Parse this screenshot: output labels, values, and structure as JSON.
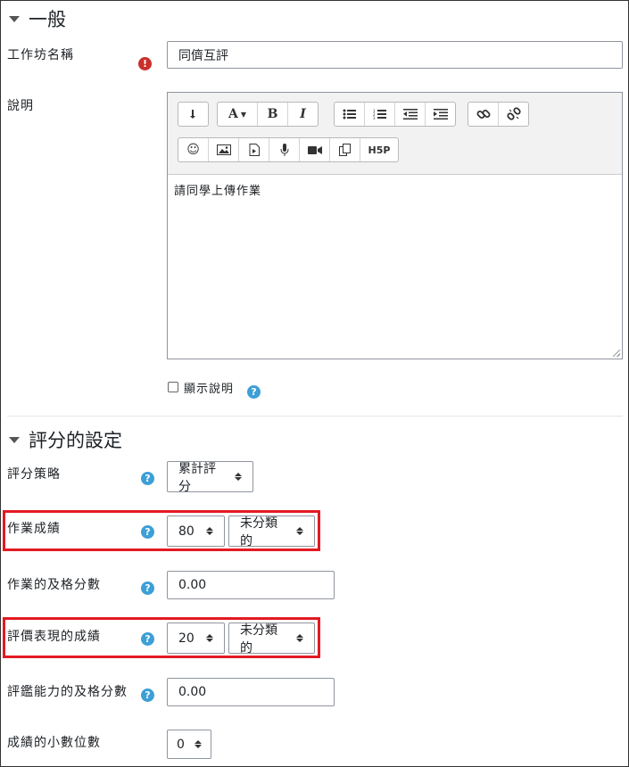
{
  "general": {
    "title": "一般",
    "workshop_name_label": "工作坊名稱",
    "workshop_name_value": "同儕互評",
    "description_label": "說明",
    "description_text": "請同學上傳作業",
    "show_description_label": "顯示說明"
  },
  "toolbar": {
    "row1": [
      "toggle-icon",
      "font-style-icon",
      "bold-icon",
      "italic-icon",
      "bullet-list-icon",
      "numbered-list-icon",
      "outdent-icon",
      "indent-icon",
      "link-icon",
      "unlink-icon"
    ],
    "font_label": "A",
    "bold_label": "B",
    "italic_label": "I",
    "h5p_label": "H5P"
  },
  "grading": {
    "title": "評分的設定",
    "strategy_label": "評分策略",
    "strategy_value": "累計評分",
    "submission_grade_label": "作業成績",
    "submission_grade_value": "80",
    "submission_category_value": "未分類的",
    "submission_pass_label": "作業的及格分數",
    "submission_pass_value": "0.00",
    "assessment_grade_label": "評價表現的成績",
    "assessment_grade_value": "20",
    "assessment_category_value": "未分類的",
    "assessment_pass_label": "評鑑能力的及格分數",
    "assessment_pass_value": "0.00",
    "decimals_label": "成績的小數位數",
    "decimals_value": "0"
  },
  "colors": {
    "highlight": "#e31a23",
    "help": "#3d9fd6",
    "required": "#c9302c"
  }
}
